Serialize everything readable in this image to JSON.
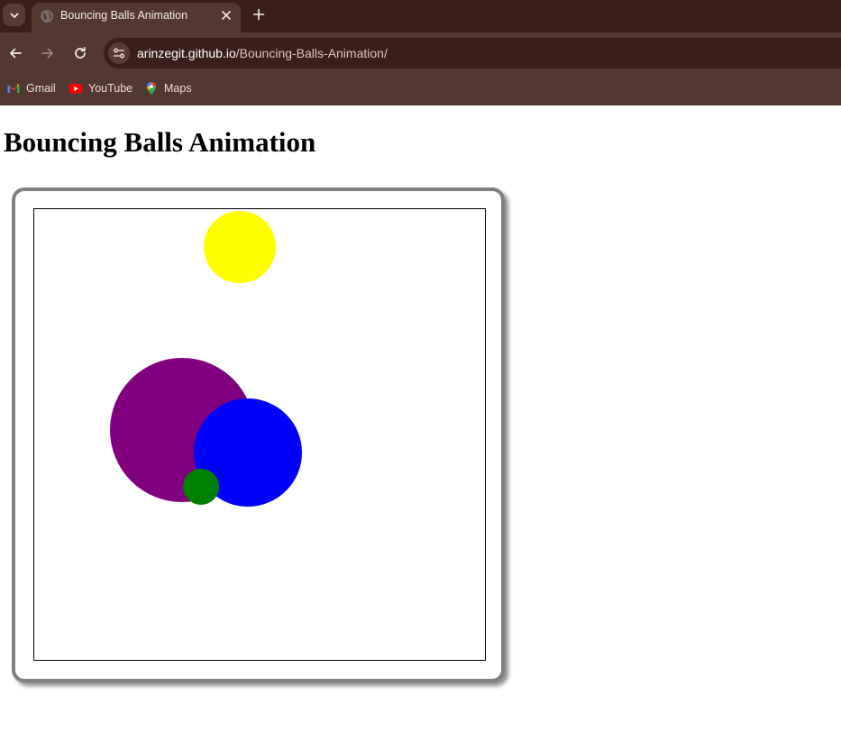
{
  "browser": {
    "tab": {
      "title": "Bouncing Balls Animation"
    },
    "url": {
      "host": "arinzegit.github.io",
      "path": "/Bouncing-Balls-Animation/"
    },
    "bookmarks": [
      {
        "label": "Gmail",
        "icon": "gmail-icon"
      },
      {
        "label": "YouTube",
        "icon": "youtube-icon"
      },
      {
        "label": "Maps",
        "icon": "maps-icon"
      }
    ],
    "colors": {
      "tabstrip": "#3a1e19",
      "toolbar": "#533731"
    }
  },
  "page": {
    "heading": "Bouncing Balls Animation"
  },
  "balls": [
    {
      "name": "yellow-ball",
      "color": "#ffff00"
    },
    {
      "name": "purple-ball",
      "color": "#800080"
    },
    {
      "name": "blue-ball",
      "color": "#0000ff"
    },
    {
      "name": "green-ball",
      "color": "#008000"
    }
  ]
}
